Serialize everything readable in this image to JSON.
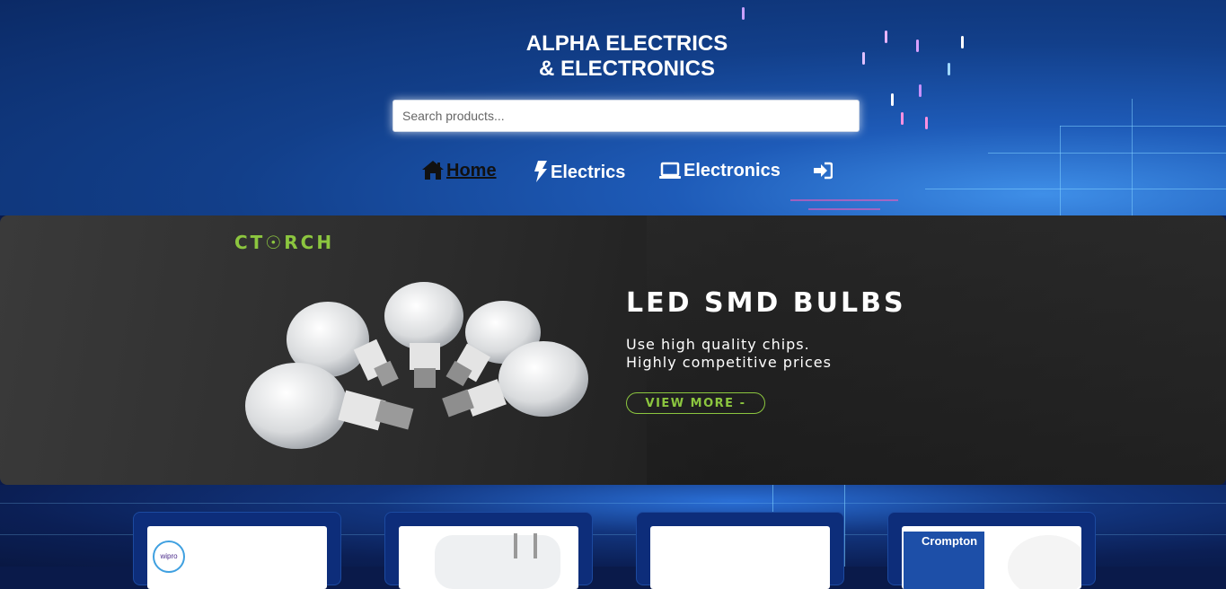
{
  "header": {
    "title_line1": "ALPHA ELECTRICS",
    "title_line2": "& ELECTRONICS",
    "search_placeholder": "Search products..."
  },
  "nav": {
    "items": [
      {
        "label": "Home",
        "icon": "home-icon",
        "active": true
      },
      {
        "label": "Electrics",
        "icon": "bolt-icon",
        "active": false
      },
      {
        "label": "Electronics",
        "icon": "laptop-icon",
        "active": false
      },
      {
        "label": "",
        "icon": "sign-in-icon",
        "active": false
      }
    ]
  },
  "banner": {
    "brand": "CT☉RCH",
    "heading": "LED SMD BULBS",
    "line1": "Use high quality chips.",
    "line2": "Highly competitive prices",
    "button": "VIEW MORE -"
  },
  "products": {
    "cards": [
      {
        "brand": "wipro"
      },
      {
        "brand": ""
      },
      {
        "brand": ""
      },
      {
        "brand": "Crompton"
      }
    ]
  },
  "colors": {
    "accent_green": "#8cc63f",
    "header_blue": "#1e5bb8"
  }
}
